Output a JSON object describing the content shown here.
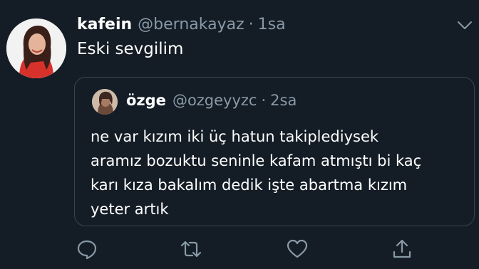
{
  "tweet": {
    "display_name": "kafein",
    "handle": "@bernakayaz",
    "separator": "·",
    "time": "1sa",
    "text": "Eski sevgilim"
  },
  "quoted_tweet": {
    "display_name": "özge",
    "handle": "@ozgeyyzc",
    "separator": "·",
    "time": "2sa",
    "text": "ne var kızım iki üç hatun takiplediysek\naramız bozuktu seninle kafam atmıştı bi kaç\nkarı kıza bakalım dedik işte abartma kızım\nyeter artık"
  },
  "icons": {
    "menu": "chevron-down-icon",
    "reply": "reply-icon",
    "retweet": "retweet-icon",
    "like": "heart-icon",
    "share": "share-icon"
  },
  "colors": {
    "background": "#141d26",
    "text": "#ffffff",
    "secondary_text": "#8899a6",
    "border": "#38444d"
  }
}
